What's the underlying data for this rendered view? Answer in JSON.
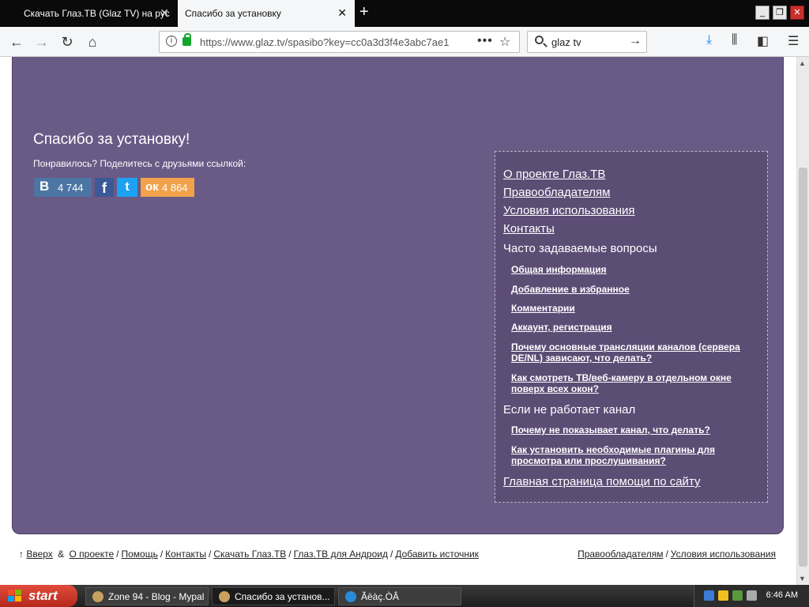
{
  "browser": {
    "tabs": [
      {
        "title": "Скачать Глаз.ТВ (Glaz TV) на рус",
        "active": false
      },
      {
        "title": "Спасибо за установку",
        "active": true
      }
    ],
    "new_tab": "+",
    "url": "https://www.glaz.tv/spasibo?key=cc0a3d3f4e3abc7ae1",
    "search_query": "glaz tv"
  },
  "page": {
    "title": "Спасибо за установку!",
    "share_prompt": "Понравилось? Поделитесь с друзьями ссылкой:",
    "share": {
      "vk_logo": "В",
      "vk_count": "4 744",
      "fb_logo": "f",
      "tw_logo": "t",
      "ok_logo": "ок",
      "ok_count": "4 864"
    },
    "help": {
      "links": [
        "О проекте Глаз.ТВ",
        "Правообладателям",
        "Условия использования",
        "Контакты"
      ],
      "faq_heading": "Часто задаваемые вопросы",
      "faq_items": [
        "Общая информация",
        "Добавление в избранное",
        "Комментарии",
        "Аккаунт, регистрация",
        "Почему основные трансляции каналов (сервера DE/NL) зависают, что делать?",
        "Как смотреть ТВ/веб-камеру в отдельном окне поверх всех окон?"
      ],
      "channel_heading": "Если не работает канал",
      "channel_items": [
        "Почему не показывает канал, что делать?",
        "Как установить необходимые плагины для просмотра или прослушивания?"
      ],
      "main_help": "Главная страница помощи по сайту"
    },
    "footer": {
      "up_arrow": "↑",
      "up": "Вверх",
      "amp": "&",
      "left_links": [
        "О проекте",
        "Помощь",
        "Контакты",
        "Скачать Глаз.ТВ",
        "Глаз.ТВ для Андроид",
        "Добавить источник"
      ],
      "right_links": [
        "Правообладателям",
        "Условия использования"
      ]
    }
  },
  "taskbar": {
    "start": "start",
    "tasks": [
      {
        "title": "Zone 94 - Blog - Mypal",
        "active": false
      },
      {
        "title": "Спасибо за установ...",
        "active": true
      },
      {
        "title": "Ãëàç.ÒÂ",
        "active": false
      }
    ],
    "clock": "6:46 AM"
  }
}
